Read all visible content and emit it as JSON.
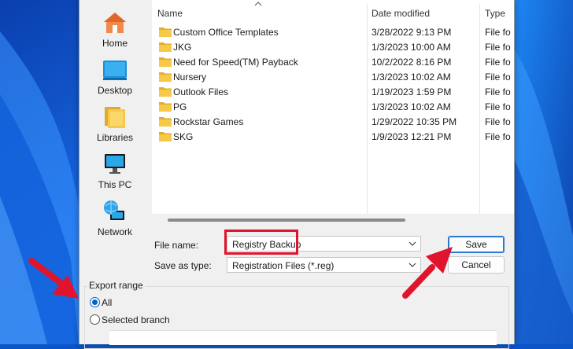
{
  "nav": {
    "home": "Home",
    "desktop": "Desktop",
    "libraries": "Libraries",
    "this_pc": "This PC",
    "network": "Network"
  },
  "columns": {
    "name": "Name",
    "date": "Date modified",
    "type": "Type"
  },
  "files": [
    {
      "name": "Custom Office Templates",
      "date": "3/28/2022 9:13 PM",
      "type": "File fo"
    },
    {
      "name": "JKG",
      "date": "1/3/2023 10:00 AM",
      "type": "File fo"
    },
    {
      "name": "Need for Speed(TM) Payback",
      "date": "10/2/2022 8:16 PM",
      "type": "File fo"
    },
    {
      "name": "Nursery",
      "date": "1/3/2023 10:02 AM",
      "type": "File fo"
    },
    {
      "name": "Outlook Files",
      "date": "1/19/2023 1:59 PM",
      "type": "File fo"
    },
    {
      "name": "PG",
      "date": "1/3/2023 10:02 AM",
      "type": "File fo"
    },
    {
      "name": "Rockstar Games",
      "date": "1/29/2022 10:35 PM",
      "type": "File fo"
    },
    {
      "name": "SKG",
      "date": "1/9/2023 12:21 PM",
      "type": "File fo"
    }
  ],
  "form": {
    "file_name_label": "File name:",
    "file_name_value": "Registry Backup",
    "save_type_label": "Save as type:",
    "save_type_value": "Registration Files (*.reg)",
    "save_button": "Save",
    "cancel_button": "Cancel"
  },
  "export": {
    "legend": "Export range",
    "all_label": "All",
    "branch_label": "Selected branch",
    "selected": "All"
  },
  "colors": {
    "accent": "#0067c0",
    "annotation_red": "#e0142c",
    "folder": "#f7c948"
  }
}
